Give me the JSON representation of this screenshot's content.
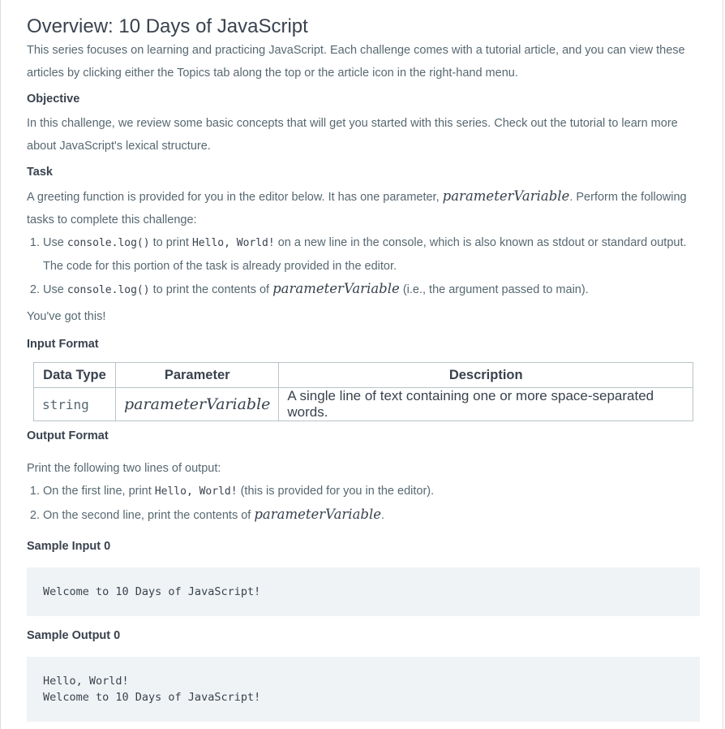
{
  "title": "Overview: 10 Days of JavaScript",
  "intro": "This series focuses on learning and practicing JavaScript. Each challenge comes with a tutorial article, and you can view these articles by clicking either the Topics tab along the top or the article icon in the right-hand menu.",
  "objective": {
    "heading": "Objective",
    "text": "In this challenge, we review some basic concepts that will get you started with this series. Check out the tutorial to learn more about JavaScript's lexical structure."
  },
  "task": {
    "heading": "Task",
    "text_before": "A greeting function is provided for you in the editor below. It has one parameter, ",
    "param": "parameterVariable",
    "text_after": ". Perform the following tasks to complete this challenge:",
    "items": [
      {
        "pre": "Use ",
        "code": "console.log()",
        "mid": " to print ",
        "code2": "Hello, World!",
        "post": " on a new line in the console, which is also known as stdout or standard output. The code for this portion of the task is already provided in the editor."
      },
      {
        "pre": "Use ",
        "code": "console.log()",
        "mid": " to print the contents of ",
        "param": "parameterVariable",
        "post": " (i.e., the argument passed to main)."
      }
    ],
    "closing": "You've got this!"
  },
  "input_format": {
    "heading": "Input Format",
    "columns": [
      "Data Type",
      "Parameter",
      "Description"
    ],
    "rows": [
      {
        "type": "string",
        "param": "parameterVariable",
        "desc": "A single line of text containing one or more space-separated words."
      }
    ]
  },
  "output_format": {
    "heading": "Output Format",
    "text": "Print the following two lines of output:",
    "items": [
      {
        "pre": "On the first line, print ",
        "code": "Hello, World!",
        "post": " (this is provided for you in the editor)."
      },
      {
        "pre": "On the second line, print the contents of ",
        "param": "parameterVariable",
        "post": "."
      }
    ]
  },
  "sample_input": {
    "heading": "Sample Input 0",
    "code": "Welcome to 10 Days of JavaScript!"
  },
  "sample_output": {
    "heading": "Sample Output 0",
    "code": "Hello, World!\nWelcome to 10 Days of JavaScript!"
  }
}
